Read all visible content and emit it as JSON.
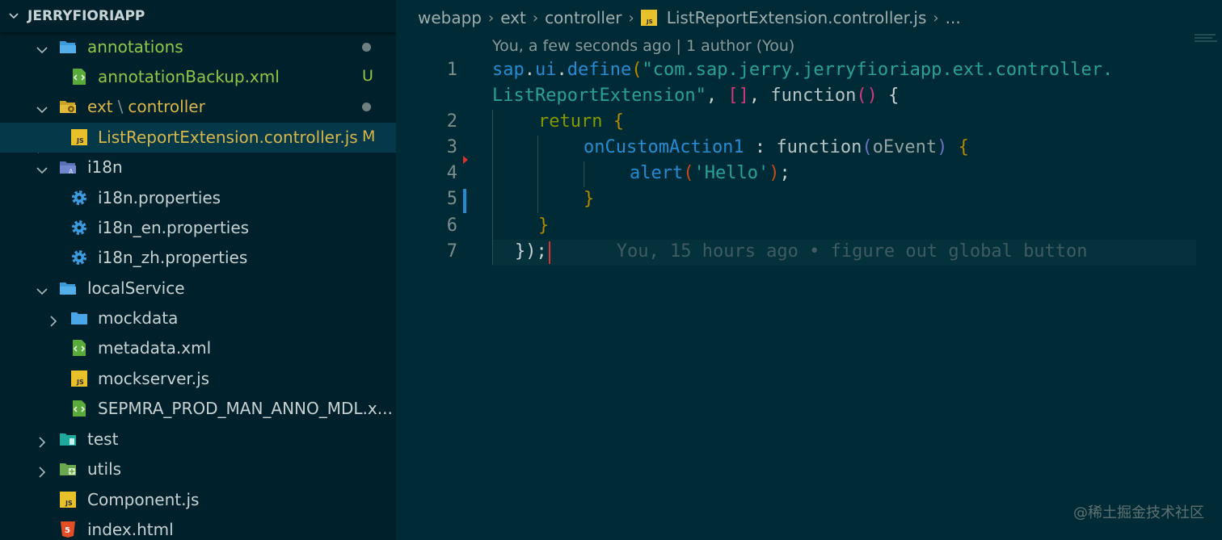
{
  "sidebar": {
    "title": "JERRYFIORIAPP",
    "items": [
      {
        "label": "annotations",
        "kind": "folder",
        "expanded": true,
        "status": "dot"
      },
      {
        "label": "annotationBackup.xml",
        "kind": "xml",
        "status": "U"
      },
      {
        "label": "ext",
        "label2": "controller",
        "kind": "folder-config",
        "expanded": true,
        "status": "dot"
      },
      {
        "label": "ListReportExtension.controller.js",
        "kind": "js",
        "status": "M",
        "selected": true
      },
      {
        "label": "i18n",
        "kind": "folder-i18n",
        "expanded": true
      },
      {
        "label": "i18n.properties",
        "kind": "gear"
      },
      {
        "label": "i18n_en.properties",
        "kind": "gear"
      },
      {
        "label": "i18n_zh.properties",
        "kind": "gear"
      },
      {
        "label": "localService",
        "kind": "folder",
        "expanded": true
      },
      {
        "label": "mockdata",
        "kind": "folder",
        "expanded": false
      },
      {
        "label": "metadata.xml",
        "kind": "xml"
      },
      {
        "label": "mockserver.js",
        "kind": "js"
      },
      {
        "label": "SEPMRA_PROD_MAN_ANNO_MDL.x...",
        "kind": "xml"
      },
      {
        "label": "test",
        "kind": "folder-test",
        "expanded": false
      },
      {
        "label": "utils",
        "kind": "folder-utils",
        "expanded": false
      },
      {
        "label": "Component.js",
        "kind": "js"
      },
      {
        "label": "index.html",
        "kind": "html"
      }
    ]
  },
  "editor": {
    "breadcrumb": [
      "webapp",
      "ext",
      "controller",
      "ListReportExtension.controller.js",
      "..."
    ],
    "blame_header": "You, a few seconds ago | 1 author (You)",
    "line_numbers": [
      "1",
      "2",
      "3",
      "4",
      "5",
      "6",
      "7"
    ],
    "code": {
      "l1a_sap": "sap",
      "l1a_dot1": ".",
      "l1a_ui": "ui",
      "l1a_dot2": ".",
      "l1a_define": "define",
      "l1a_paren": "(",
      "l1a_str": "\"com.sap.jerry.jerryfioriapp.ext.controller.",
      "l1b_str": "ListReportExtension\"",
      "l1b_comma": ", ",
      "l1b_arr": "[]",
      "l1b_comma2": ", ",
      "l1b_function": "function",
      "l1b_parens": "()",
      "l1b_brace": " {",
      "l2_return": "return",
      "l2_brace": " {",
      "l3_name": "onCustomAction1",
      "l3_colon": " : ",
      "l3_function": "function",
      "l3_popen": "(",
      "l3_param": "oEvent",
      "l3_pclose": ")",
      "l3_brace": " {",
      "l4_alert": "alert",
      "l4_popen": "(",
      "l4_str": "'Hello'",
      "l4_pclose": ")",
      "l4_semi": ";",
      "l5_brace": "}",
      "l6_brace": "}",
      "l7_close": "});",
      "l7_blame": "You, 15 hours ago • figure out global button"
    }
  },
  "watermark": "@稀土掘金技术社区"
}
